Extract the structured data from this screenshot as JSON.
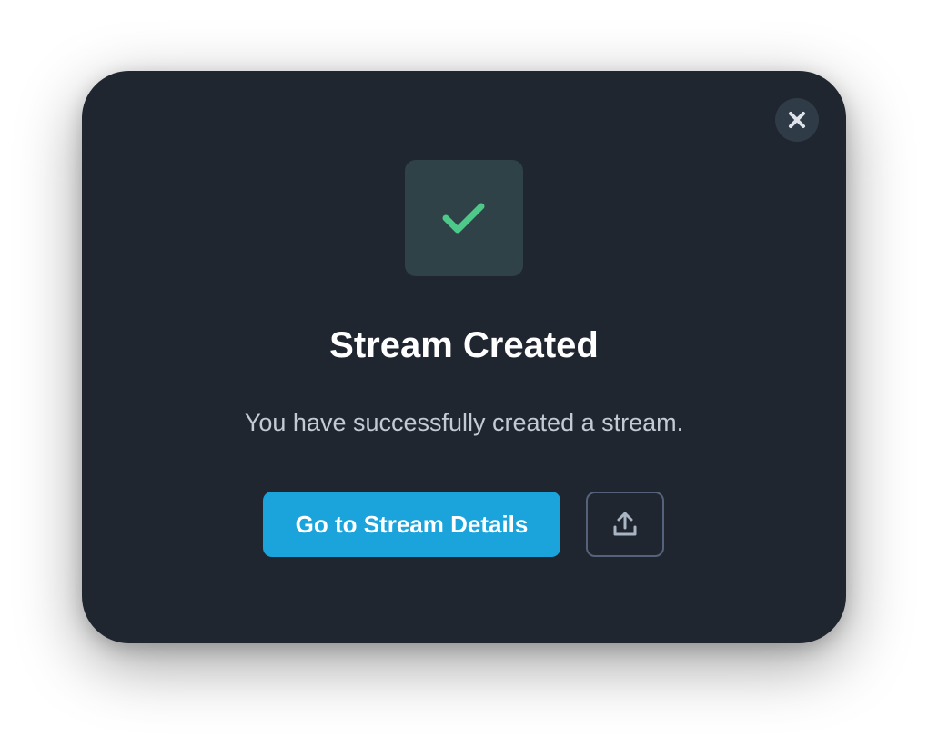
{
  "dialog": {
    "title": "Stream Created",
    "message": "You have successfully created a stream.",
    "primary_button_label": "Go to Stream Details",
    "close_icon": "close-icon",
    "success_icon": "checkmark-icon",
    "share_icon": "share-upload-icon"
  },
  "colors": {
    "dialog_background": "#1f2630",
    "accent": "#1ba3dc",
    "success": "#4fc98a",
    "success_tile": "#2f4248",
    "muted_text": "#c3cad3",
    "border": "#55637a"
  }
}
